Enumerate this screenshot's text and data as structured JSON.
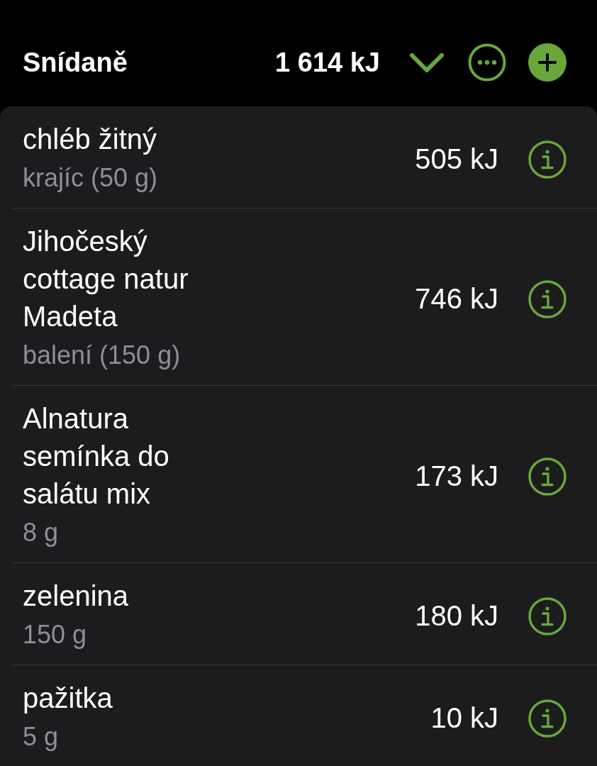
{
  "header": {
    "title": "Snídaně",
    "total": "1 614 kJ"
  },
  "items": [
    {
      "name": "chléb žitný",
      "portion": "krajíc (50 g)",
      "energy": "505 kJ"
    },
    {
      "name": "Jihočeský cottage natur Madeta",
      "portion": "balení (150 g)",
      "energy": "746 kJ"
    },
    {
      "name": "Alnatura semínka do salátu mix",
      "portion": "8 g",
      "energy": "173 kJ"
    },
    {
      "name": "zelenina",
      "portion": "150 g",
      "energy": "180 kJ"
    },
    {
      "name": "pažitka",
      "portion": "5 g",
      "energy": "10 kJ"
    }
  ]
}
